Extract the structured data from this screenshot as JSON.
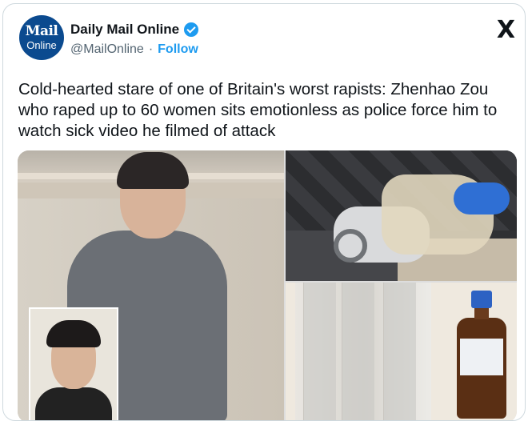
{
  "account": {
    "avatar_line1": "Mail",
    "avatar_line2": "Online",
    "display_name": "Daily Mail Online",
    "handle": "@MailOnline",
    "separator": "·",
    "follow_label": "Follow",
    "verified_icon": "verified-badge-icon"
  },
  "platform_logo": "X",
  "tweet": {
    "text": "Cold-hearted stare of one of Britain's worst rapists: Zhenhao Zou who raped up to 60 women sits emotionless as police force him to watch sick video he filmed of attack"
  },
  "colors": {
    "accent": "#1d9bf0",
    "text": "#0f1419",
    "secondary_text": "#536471",
    "border": "#cfd9de"
  }
}
